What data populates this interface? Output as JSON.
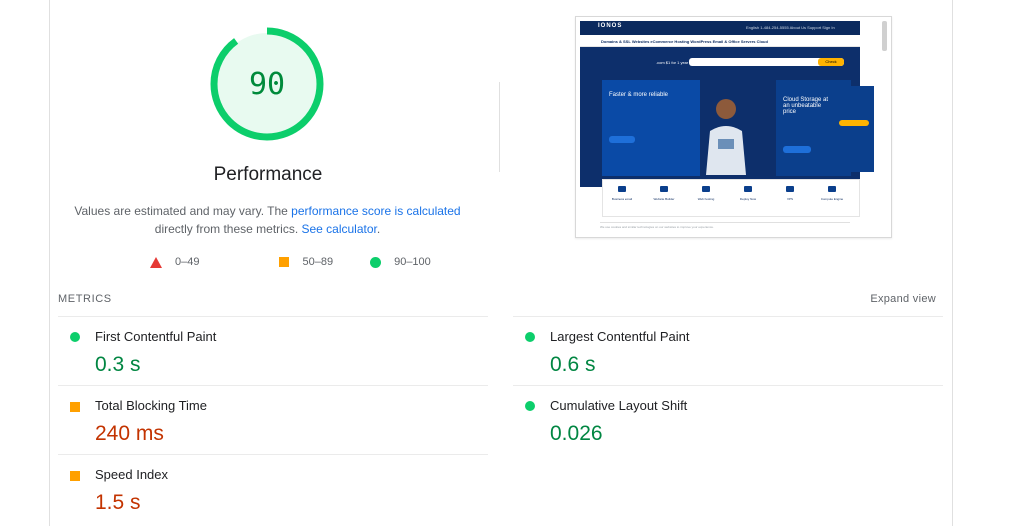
{
  "gauge": {
    "score": "90",
    "score_fraction": 0.9,
    "title": "Performance",
    "ring_color": "#0cce6b",
    "fill_color": "#e8faf0",
    "text_color": "#008a3b"
  },
  "note": {
    "text1": "Values are estimated and may vary. The ",
    "link1": "performance score is calculated",
    "text2": " directly from these metrics. ",
    "link2": "See calculator",
    "text3": "."
  },
  "legend": [
    {
      "icon": "triangle-icon",
      "label": "0–49",
      "color": "#e53935"
    },
    {
      "icon": "square-icon",
      "label": "50–89",
      "color": "#ffa000"
    },
    {
      "icon": "circle-icon",
      "label": "90–100",
      "color": "#0cce6b"
    }
  ],
  "screenshot": {
    "logo": "IONOS",
    "top_right": "English   1-484-254-5555   About Us   Support   Sign In",
    "nav": "Domains & SSL   Websites   eCommerce   Hosting   WordPress   Email & Office   Servers   Cloud",
    "domain_text": ".com  $1 for 1 year",
    "search_placeholder": "Find your domain now",
    "check_label": "Check",
    "card1_kicker": "WordPress Hosting",
    "card1_title": "Faster & more reliable",
    "card2_kicker": "IONOS Object Storage",
    "card2_title": "Cloud Storage at an unbeatable price",
    "side_badge": "Now at IONOS",
    "side_text": "Personal consultant",
    "products": [
      "Business email",
      "Website Builder",
      "Web hosting",
      "Deploy Now",
      "VPS",
      "Compute Engine"
    ],
    "footer": "We use cookies and similar technologies on our websites to improve your experience."
  },
  "metrics": {
    "header": "METRICS",
    "expand": "Expand view",
    "items": [
      {
        "label": "First Contentful Paint",
        "value": "0.3 s",
        "status": "good"
      },
      {
        "label": "Largest Contentful Paint",
        "value": "0.6 s",
        "status": "good"
      },
      {
        "label": "Total Blocking Time",
        "value": "240 ms",
        "status": "average"
      },
      {
        "label": "Cumulative Layout Shift",
        "value": "0.026",
        "status": "good"
      },
      {
        "label": "Speed Index",
        "value": "1.5 s",
        "status": "average"
      }
    ]
  }
}
